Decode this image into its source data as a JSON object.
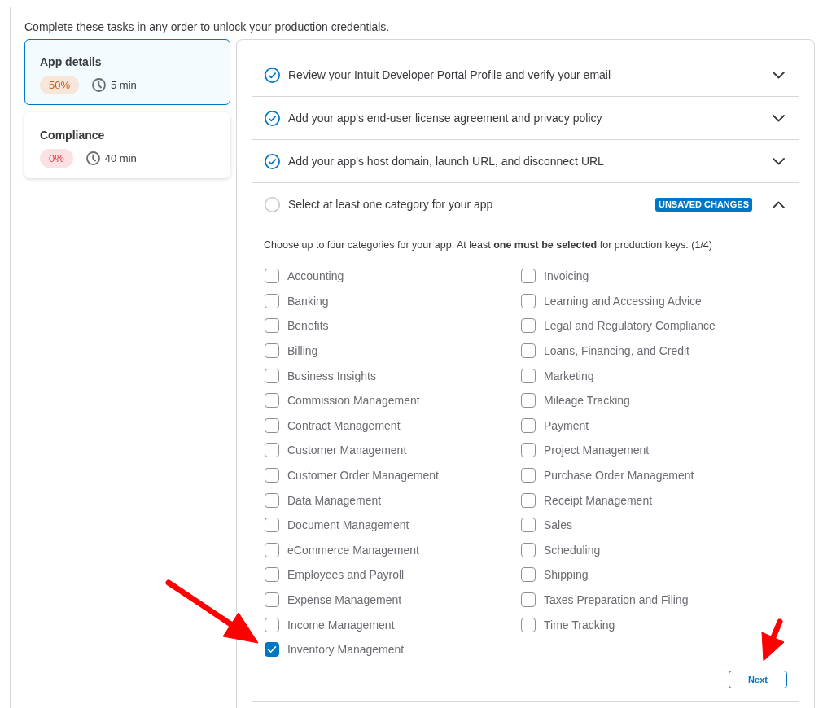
{
  "intro": "Complete these tasks in any order to unlock your production credentials.",
  "task_groups": [
    {
      "title": "App details",
      "selected": true,
      "progress": "50%",
      "color": "#cf5a0c",
      "duration": "5 min"
    },
    {
      "title": "Compliance",
      "selected": false,
      "progress": "0%",
      "color": "#e3343f",
      "duration": "40 min"
    }
  ],
  "tasks": [
    {
      "title": "Review your Intuit Developer Portal Profile and verify your email",
      "done": true,
      "expanded": false
    },
    {
      "title": "Add your app's end-user license agreement and privacy policy",
      "done": true,
      "expanded": false
    },
    {
      "title": "Add your app's host domain, launch URL, and disconnect URL",
      "done": true,
      "expanded": false
    },
    {
      "title": "Select at least one category for your app",
      "done": false,
      "expanded": true,
      "badge": "UNSAVED CHANGES",
      "body": {
        "hint": "Choose up to four categories for your app. At least **one must be selected** for production keys. (1/4)",
        "options": [
          {
            "label": "Accounting",
            "checked": false
          },
          {
            "label": "Banking",
            "checked": false
          },
          {
            "label": "Benefits",
            "checked": false
          },
          {
            "label": "Billing",
            "checked": false
          },
          {
            "label": "Business Insights",
            "checked": false
          },
          {
            "label": "Commission Management",
            "checked": false
          },
          {
            "label": "Contract Management",
            "checked": false
          },
          {
            "label": "Customer Management",
            "checked": false
          },
          {
            "label": "Customer Order Management",
            "checked": false
          },
          {
            "label": "Data Management",
            "checked": false
          },
          {
            "label": "Document Management",
            "checked": false
          },
          {
            "label": "eCommerce Management",
            "checked": false
          },
          {
            "label": "Employees and Payroll",
            "checked": false
          },
          {
            "label": "Expense Management",
            "checked": false
          },
          {
            "label": "Income Management",
            "checked": false
          },
          {
            "label": "Inventory Management",
            "checked": true
          },
          {
            "label": "Invoicing",
            "checked": false
          },
          {
            "label": "Learning and Accessing Advice",
            "checked": false
          },
          {
            "label": "Legal and Regulatory Compliance",
            "checked": false
          },
          {
            "label": "Loans, Financing, and Credit",
            "checked": false
          },
          {
            "label": "Marketing",
            "checked": false
          },
          {
            "label": "Mileage Tracking",
            "checked": false
          },
          {
            "label": "Payment",
            "checked": false
          },
          {
            "label": "Project Management",
            "checked": false
          },
          {
            "label": "Purchase Order Management",
            "checked": false
          },
          {
            "label": "Receipt Management",
            "checked": false
          },
          {
            "label": "Sales",
            "checked": false
          },
          {
            "label": "Scheduling",
            "checked": false
          },
          {
            "label": "Shipping",
            "checked": false
          },
          {
            "label": "Taxes Preparation and Filing",
            "checked": false
          },
          {
            "label": "Time Tracking",
            "checked": false
          }
        ],
        "next_button": "Next"
      }
    }
  ]
}
